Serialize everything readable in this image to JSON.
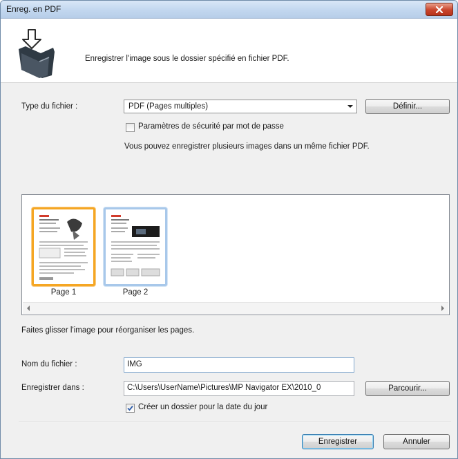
{
  "window": {
    "title": "Enreg. en PDF",
    "close_icon": "close-icon"
  },
  "header": {
    "icon": "save-to-folder-icon",
    "description": "Enregistrer l'image sous le dossier spécifié en fichier PDF."
  },
  "file_type": {
    "label": "Type du fichier :",
    "selected": "PDF (Pages multiples)",
    "define_button": "Définir...",
    "password_checkbox_label": "Paramètres de sécurité par mot de passe",
    "password_checked": false,
    "hint": "Vous pouvez enregistrer plusieurs images dans un même fichier PDF."
  },
  "preview": {
    "pages": [
      {
        "label": "Page 1",
        "selected": true
      },
      {
        "label": "Page 2",
        "selected": false
      }
    ],
    "instruction": "Faites glisser l'image pour réorganiser les pages."
  },
  "file_name": {
    "label": "Nom du fichier :",
    "value": "IMG"
  },
  "save_in": {
    "label": "Enregistrer dans :",
    "value": "C:\\Users\\UserName\\Pictures\\MP Navigator EX\\2010_0",
    "browse_button": "Parcourir...",
    "date_folder_label": "Créer un dossier pour la date du jour",
    "date_folder_checked": true
  },
  "footer": {
    "save_button": "Enregistrer",
    "cancel_button": "Annuler"
  },
  "colors": {
    "selected_page_border": "#f5a623",
    "unselected_page_border": "#a8c8ea",
    "close_button": "#c9452c"
  }
}
